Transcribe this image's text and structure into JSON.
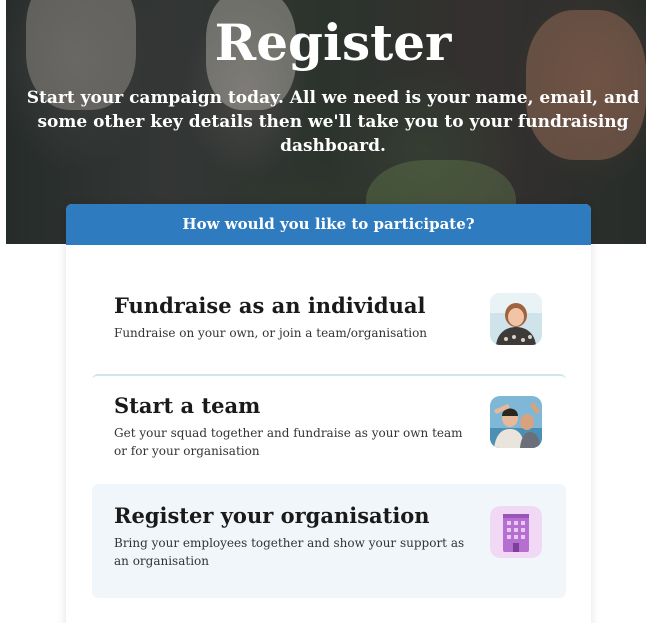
{
  "hero": {
    "title": "Register",
    "subtitle": "Start your campaign today. All we need is your name, email, and some other key details then we'll take you to your fundraising dashboard."
  },
  "card": {
    "header": "How would you like to participate?",
    "options": [
      {
        "title": "Fundraise as an individual",
        "description": "Fundraise on your own, or join a team/organisation",
        "icon": "individual-photo-icon"
      },
      {
        "title": "Start a team",
        "description": "Get your squad together and fundraise as your own team or for your organisation",
        "icon": "team-photo-icon"
      },
      {
        "title": "Register your organisation",
        "description": "Bring your employees together and show your support as an organisation",
        "icon": "building-icon"
      }
    ]
  },
  "colors": {
    "header_blue": "#2f7bbf",
    "divider": "#cfe6ee",
    "selected_bg": "#f1f6fb",
    "building_purple": "#b46fd1"
  }
}
